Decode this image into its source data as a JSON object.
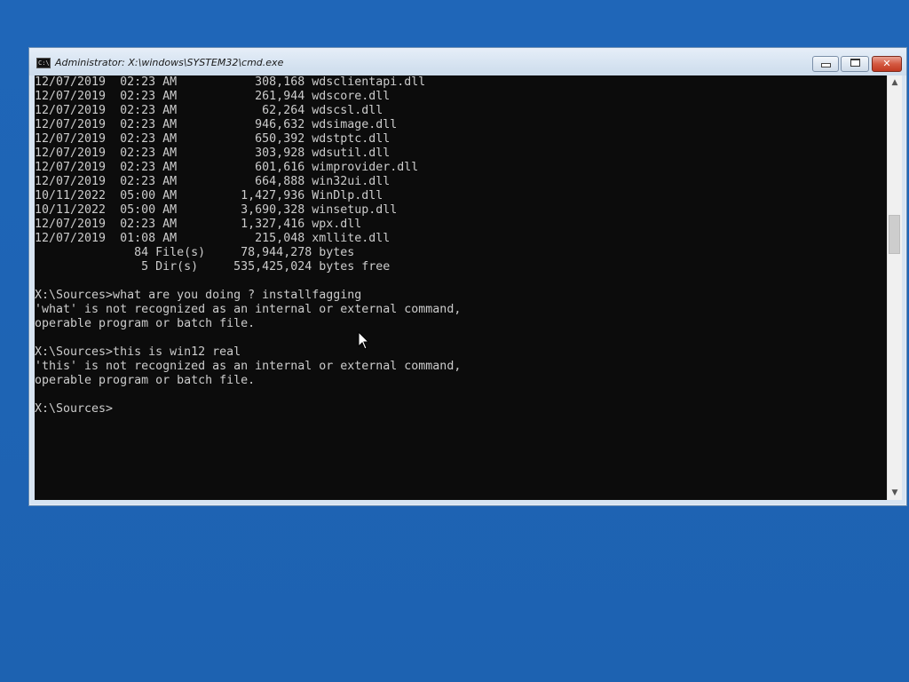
{
  "window": {
    "title": "Administrator: X:\\windows\\SYSTEM32\\cmd.exe",
    "icon_label": "C:\\",
    "buttons": {
      "minimize": "minimize",
      "maximize": "maximize",
      "close": "✕"
    }
  },
  "console": {
    "lines": [
      "12/07/2019  02:23 AM           308,168 wdsclientapi.dll",
      "12/07/2019  02:23 AM           261,944 wdscore.dll",
      "12/07/2019  02:23 AM            62,264 wdscsl.dll",
      "12/07/2019  02:23 AM           946,632 wdsimage.dll",
      "12/07/2019  02:23 AM           650,392 wdstptc.dll",
      "12/07/2019  02:23 AM           303,928 wdsutil.dll",
      "12/07/2019  02:23 AM           601,616 wimprovider.dll",
      "12/07/2019  02:23 AM           664,888 win32ui.dll",
      "10/11/2022  05:00 AM         1,427,936 WinDlp.dll",
      "10/11/2022  05:00 AM         3,690,328 winsetup.dll",
      "12/07/2019  02:23 AM         1,327,416 wpx.dll",
      "12/07/2019  01:08 AM           215,048 xmllite.dll",
      "              84 File(s)     78,944,278 bytes",
      "               5 Dir(s)     535,425,024 bytes free",
      "",
      "X:\\Sources>what are you doing ? installfagging",
      "'what' is not recognized as an internal or external command,",
      "operable program or batch file.",
      "",
      "X:\\Sources>this is win12 real",
      "'this' is not recognized as an internal or external command,",
      "operable program or batch file.",
      "",
      "X:\\Sources>"
    ]
  },
  "scrollbar": {
    "up_arrow": "▲",
    "down_arrow": "▼",
    "position_fraction": 0.35
  },
  "colors": {
    "desktop": "#1e64b4",
    "console_bg": "#0c0c0c",
    "console_fg": "#cccccc"
  }
}
